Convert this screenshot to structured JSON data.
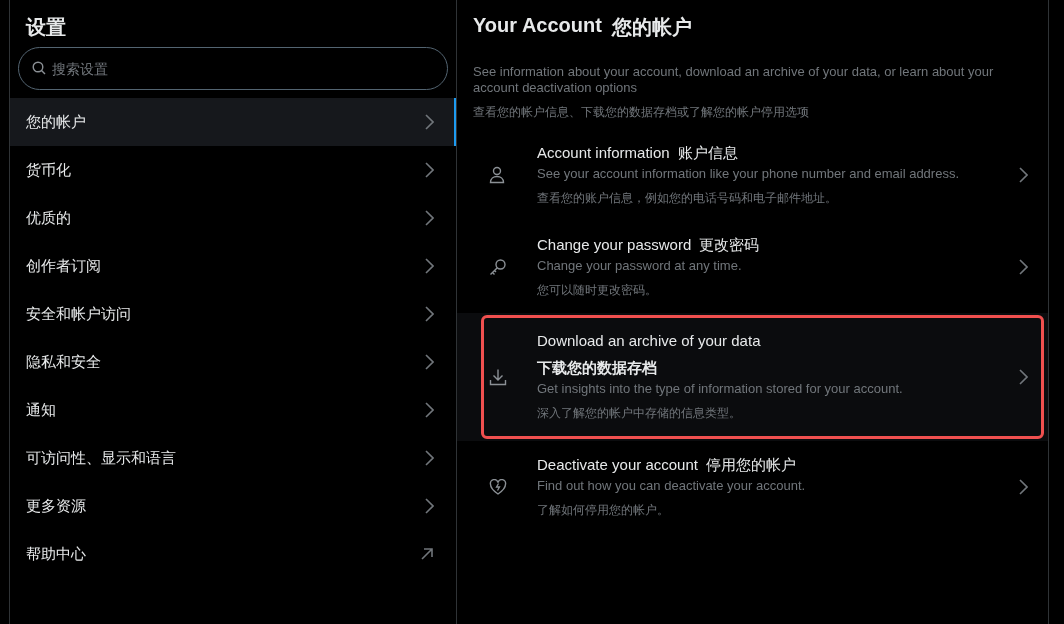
{
  "sidebar": {
    "title": "设置",
    "search": {
      "placeholder": "搜索设置"
    },
    "items": [
      {
        "label": "您的帐户",
        "selected": true,
        "kind": "page"
      },
      {
        "label": "货币化",
        "selected": false,
        "kind": "page"
      },
      {
        "label": "优质的",
        "selected": false,
        "kind": "page"
      },
      {
        "label": "创作者订阅",
        "selected": false,
        "kind": "page"
      },
      {
        "label": "安全和帐户访问",
        "selected": false,
        "kind": "page"
      },
      {
        "label": "隐私和安全",
        "selected": false,
        "kind": "page"
      },
      {
        "label": "通知",
        "selected": false,
        "kind": "page"
      },
      {
        "label": "可访问性、显示和语言",
        "selected": false,
        "kind": "page"
      },
      {
        "label": "更多资源",
        "selected": false,
        "kind": "page"
      },
      {
        "label": "帮助中心",
        "selected": false,
        "kind": "external"
      }
    ]
  },
  "main": {
    "title": "Your Account",
    "title_zh": "您的帐户",
    "description": "See information about your account, download an archive of your data, or learn about your account deactivation options",
    "description_zh": "查看您的帐户信息、下载您的数据存档或了解您的帐户停用选项",
    "items": [
      {
        "kind": "person",
        "title": "Account information",
        "title_zh": "账户信息",
        "stacked": false,
        "highlighted": false,
        "description": "See your account information like your phone number and email address.",
        "description_zh": "查看您的账户信息，例如您的电话号码和电子邮件地址。"
      },
      {
        "kind": "key",
        "title": "Change your password",
        "title_zh": "更改密码",
        "stacked": false,
        "highlighted": false,
        "description": "Change your password at any time.",
        "description_zh": "您可以随时更改密码。"
      },
      {
        "kind": "download",
        "title": "Download an archive of your data",
        "title_zh": "下载您的数据存档",
        "stacked": true,
        "highlighted": true,
        "description": "Get insights into the type of information stored for your account.",
        "description_zh": "深入了解您的帐户中存储的信息类型。"
      },
      {
        "kind": "heart",
        "title": "Deactivate your account",
        "title_zh": "停用您的帐户",
        "stacked": false,
        "highlighted": false,
        "description": "Find out how you can deactivate your account.",
        "description_zh": "了解如何停用您的帐户。"
      }
    ]
  }
}
